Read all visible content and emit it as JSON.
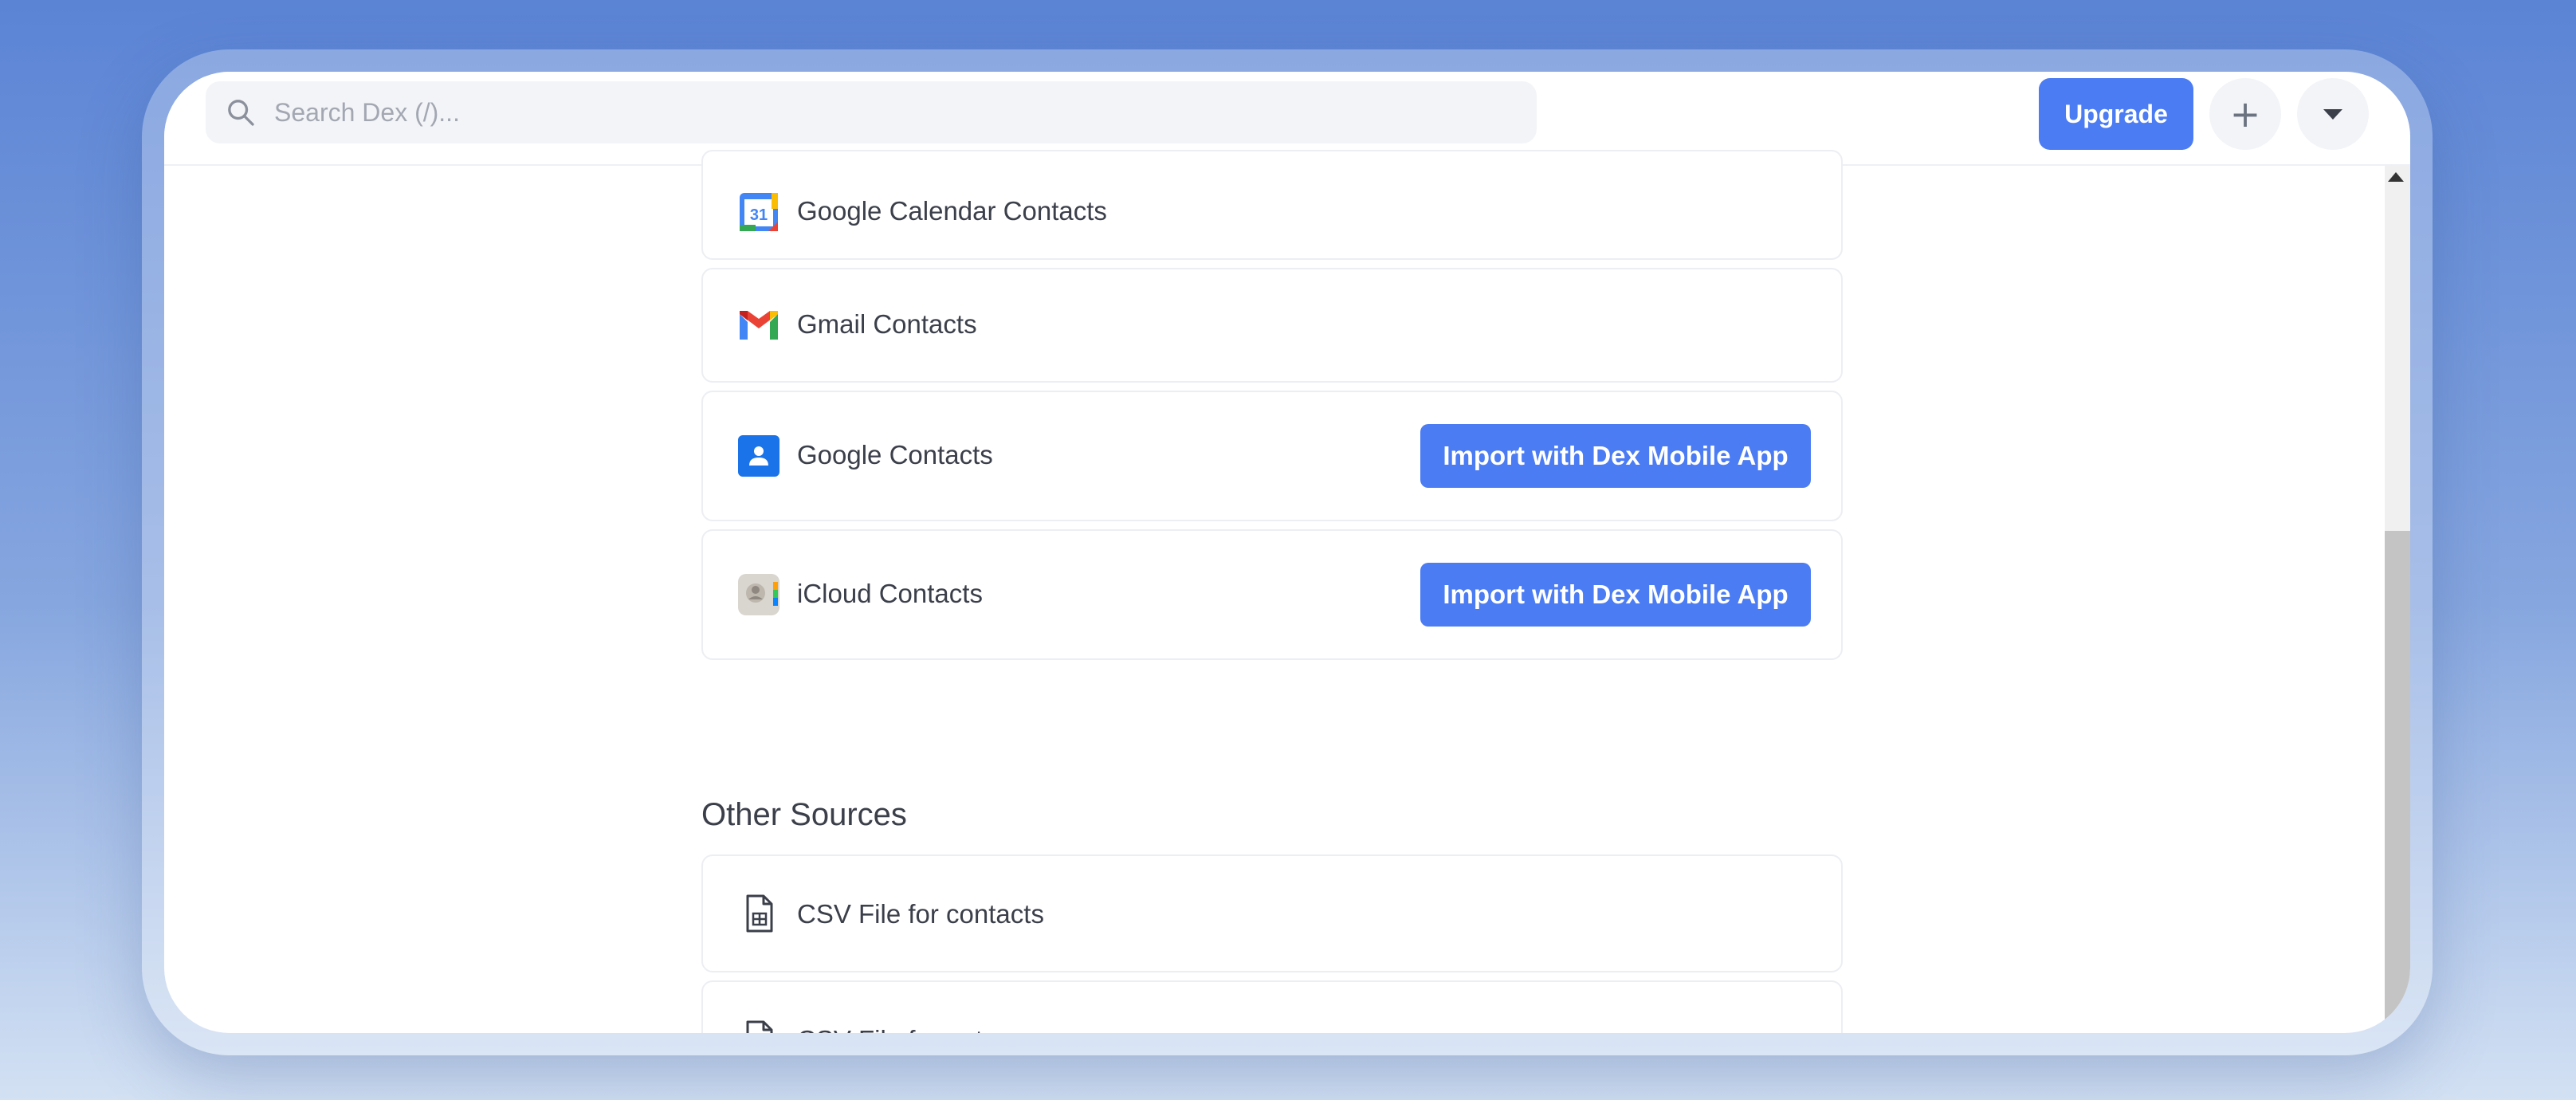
{
  "search": {
    "placeholder": "Search Dex (/)..."
  },
  "header": {
    "upgrade_label": "Upgrade",
    "plus_label": "+"
  },
  "connected_sources": [
    {
      "label": "Google Calendar Contacts",
      "icon": "google-calendar-icon"
    },
    {
      "label": "Gmail Contacts",
      "icon": "gmail-icon"
    },
    {
      "label": "Google Contacts",
      "icon": "google-contacts-icon",
      "action": "Import with Dex Mobile App"
    },
    {
      "label": "iCloud Contacts",
      "icon": "icloud-contacts-icon",
      "action": "Import with Dex Mobile App"
    }
  ],
  "other_sources": {
    "title": "Other Sources",
    "items": [
      {
        "label": "CSV File for contacts",
        "icon": "csv-file-icon"
      },
      {
        "label": "CSV File for notes",
        "icon": "excel-file-icon"
      }
    ]
  },
  "colors": {
    "accent": "#4b7cf4",
    "text": "#3b3f4a",
    "border": "#eceef2"
  }
}
